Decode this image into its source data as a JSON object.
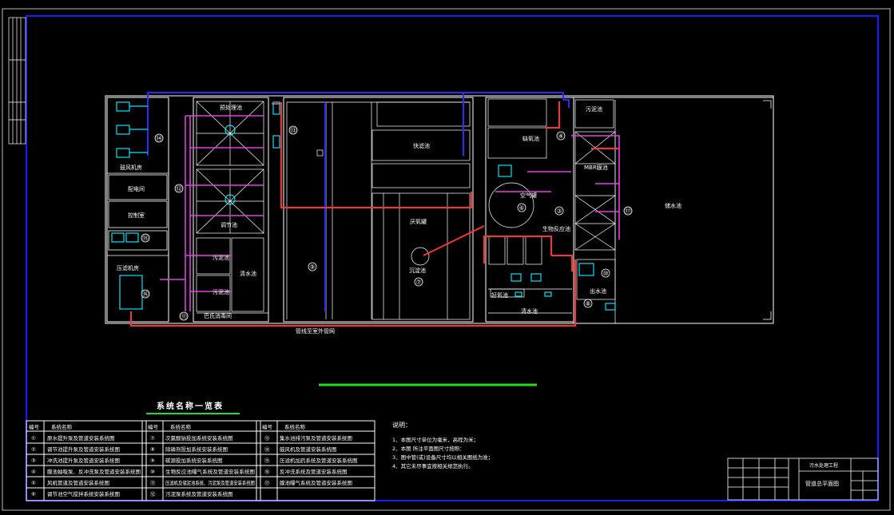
{
  "drawing": {
    "colors": {
      "background": "#000000",
      "border_blue": "#1a1aff",
      "white_lines": "#ffffff",
      "red_pipe": "#ff3030",
      "magenta_pipe": "#e040e0",
      "blue_pipe": "#2a2aff",
      "cyan_equipment": "#00e5ff",
      "green_line": "#22dd22",
      "yellow": "#ffff00"
    },
    "rooms": {
      "fan_room": "鼓风机房",
      "power_room": "配电间",
      "control_room": "控制室",
      "press_room": "压滤机房",
      "pre_tank": "预处理池",
      "reg_tank": "调节池",
      "sludge_tank_a": "污泥池",
      "sludge_tank_b": "污泥池",
      "clean_tank": "清水池",
      "heat_room": "巴氏消毒间",
      "filter_tank": "快滤池",
      "sed_tank": "沉淀池",
      "anaerobic_tank": "厌氧罐",
      "anoxic_tank": "缺氧池",
      "air_tank": "空气罐",
      "bio_tank": "生物反应池",
      "aerobic_tank": "好氧池",
      "clear_tank": "清水池",
      "sludge_dry": "污泥池",
      "outlet_tank": "出水池",
      "mbr_tank": "MBR膜池",
      "storage_tank": "储水池",
      "ext_pipe": "管线至室外管网"
    },
    "markers": [
      "⑭",
      "⑫",
      "⑬",
      "⑮",
      "⑯",
      "⑪",
      "⑨",
      "⑦",
      "⑥",
      "④",
      "③",
      "⑰",
      "⑧",
      "⑩"
    ]
  },
  "table": {
    "title": "系统名称一览表",
    "headers": {
      "num": "编号",
      "name": "系统名称"
    },
    "col1": [
      {
        "num": "①",
        "name": "原水提升泵及管道安装系统图"
      },
      {
        "num": "②",
        "name": "调节池提升泵及管道安装系统图"
      },
      {
        "num": "③",
        "name": "冲洗池提升泵及管道安装系统图"
      },
      {
        "num": "④",
        "name": "膜池抽吸泵、反冲洗泵及管道安装系统图"
      },
      {
        "num": "⑤",
        "name": "风机管道及管道安装系统图"
      },
      {
        "num": "⑥",
        "name": "调节池空气搅拌系统安装系统图"
      }
    ],
    "col2": [
      {
        "num": "⑦",
        "name": "次氯酸钠投加系统安装系统图"
      },
      {
        "num": "⑧",
        "name": "除磷剂投加系统安装系统图"
      },
      {
        "num": "⑨",
        "name": "碳源投加系统安装系统图"
      },
      {
        "num": "⑩",
        "name": "生物反应池曝气系统及管道安装系统图"
      },
      {
        "num": "⑪",
        "name": "压滤机及储泥池系统、污泥泵及管道安装系统图"
      },
      {
        "num": "⑫",
        "name": "污泥泵系统及管道安装系统图"
      }
    ],
    "col3": [
      {
        "num": "⑬",
        "name": "集水池排污泵及管道安装系统图"
      },
      {
        "num": "⑭",
        "name": "鼓风机及管道安装系统图"
      },
      {
        "num": "⑮",
        "name": "压滤机加药系统及管道安装系统图"
      },
      {
        "num": "⑯",
        "name": "反冲洗系统及管道安装系统图"
      },
      {
        "num": "⑰",
        "name": "膜池曝气系统及管道安装系统图"
      },
      {
        "num": ""
      }
    ]
  },
  "notes": {
    "heading": "说明：",
    "lines": [
      "1、本图尺寸单位为毫米，高程为米；",
      "2、本图  所注平面图尺寸按照：",
      "3、图中管(或)设备尺寸均以相关图纸为准；",
      "4、其它未尽事宜按相关规范执行。"
    ]
  },
  "title_block": {
    "project": "污水处理工程",
    "drawing_name": "管道总平面图"
  }
}
